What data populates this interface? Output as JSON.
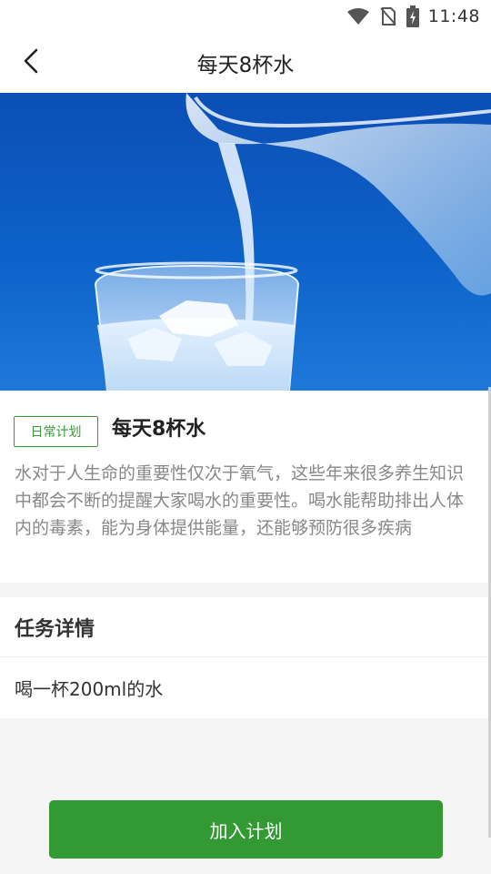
{
  "status_bar": {
    "time": "11:48",
    "icons": [
      "wifi-icon",
      "no-sim-icon",
      "battery-charging-icon"
    ]
  },
  "app_bar": {
    "title": "每天8杯水",
    "back_icon": "back-arrow-icon"
  },
  "hero_image": {
    "subject": "water-pouring-into-glass-image"
  },
  "plan": {
    "tag": "日常计划",
    "title": "每天8杯水",
    "description": "水对于人生命的重要性仅次于氧气，这些年来很多养生知识中都会不断的提醒大家喝水的重要性。喝水能帮助排出人体内的毒素，能为身体提供能量，还能够预防很多疾病"
  },
  "task_section": {
    "heading": "任务详情",
    "detail": "喝一杯200ml的水"
  },
  "actions": {
    "join_label": "加入计划"
  },
  "colors": {
    "accent": "#339a33",
    "tag_border": "#3a9a3a",
    "background": "#f5f5f5",
    "text_secondary": "#888888"
  }
}
